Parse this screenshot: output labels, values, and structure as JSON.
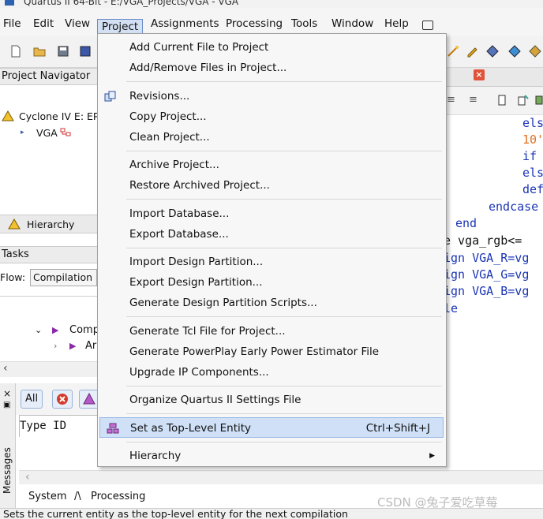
{
  "title_bar": {
    "text": "Quartus II 64-Bit - E:/VGA_Projects/VGA - VGA"
  },
  "menubar": {
    "items": [
      "File",
      "Edit",
      "View",
      "Project",
      "Assignments",
      "Processing",
      "Tools",
      "Window",
      "Help"
    ],
    "active": "Project"
  },
  "project_navigator": {
    "header": "Project Navigator",
    "device": "Cyclone IV E: EP",
    "entity": "VGA",
    "tab": "Hierarchy"
  },
  "tasks": {
    "header": "Tasks",
    "flow_label": "Flow:",
    "flow_value": "Compilation",
    "item_compile": "Comp",
    "item_analysis": "Ar"
  },
  "editor": {
    "close_tab_glyph": "×",
    "code_lines": [
      "els",
      "10'",
      "if",
      "els",
      "def",
      "endcase",
      "end",
      "e vga_rgb<=",
      "ign VGA_R=vg",
      "ign VGA_G=vg",
      "ign VGA_B=vg",
      "le"
    ]
  },
  "messages": {
    "side_label": "Messages",
    "filter_all": "All",
    "columns": "Type  ID",
    "tabs": [
      "System",
      "Processing"
    ]
  },
  "project_menu": {
    "items": [
      {
        "label": "Add Current File to Project"
      },
      {
        "label": "Add/Remove Files in Project..."
      },
      {
        "label": "Revisions..."
      },
      {
        "label": "Copy Project..."
      },
      {
        "label": "Clean Project..."
      },
      {
        "label": "Archive Project..."
      },
      {
        "label": "Restore Archived Project..."
      },
      {
        "label": "Import Database..."
      },
      {
        "label": "Export Database..."
      },
      {
        "label": "Import Design Partition..."
      },
      {
        "label": "Export Design Partition..."
      },
      {
        "label": "Generate Design Partition Scripts..."
      },
      {
        "label": "Generate Tcl File for Project..."
      },
      {
        "label": "Generate PowerPlay Early Power Estimator File"
      },
      {
        "label": "Upgrade IP Components..."
      },
      {
        "label": "Organize Quartus II Settings File"
      },
      {
        "label": "Set as Top-Level Entity",
        "shortcut": "Ctrl+Shift+J"
      },
      {
        "label": "Hierarchy"
      }
    ]
  },
  "watermark": "CSDN @兔子爱吃草莓",
  "status_bar": {
    "text": "Sets the current entity as the top-level entity for the next compilation"
  },
  "colors": {
    "menu_highlight": "#cfe0f7",
    "keyword_blue": "#1b35b4",
    "literal_orange": "#e07020",
    "close_red": "#e0533a"
  }
}
